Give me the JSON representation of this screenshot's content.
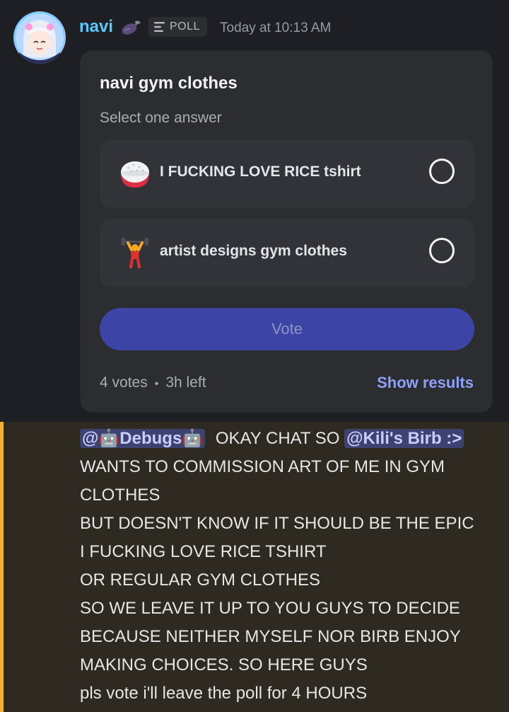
{
  "message": {
    "author": "navi",
    "tag": "POLL",
    "timestamp": "Today at 10:13 AM"
  },
  "poll": {
    "question": "navi gym clothes",
    "hint": "Select one answer",
    "answers": [
      {
        "emoji": "rice-bowl",
        "label": "I FUCKING LOVE RICE tshirt"
      },
      {
        "emoji": "person-lifting-weights",
        "label": "artist designs gym clothes"
      }
    ],
    "vote_label": "Vote",
    "votes": "4 votes",
    "separator": "•",
    "time_left": "3h left",
    "show_results": "Show results"
  },
  "reply": {
    "mention_1": "@🤖Debugs🤖",
    "text_1": "OKAY CHAT SO",
    "mention_2": "@Kili's Birb :>",
    "lines": [
      "WANTS TO COMMISSION ART OF ME IN GYM",
      "CLOTHES",
      "BUT DOESN'T KNOW IF IT SHOULD BE THE EPIC",
      "I FUCKING LOVE RICE TSHIRT",
      "OR REGULAR GYM CLOTHES",
      "SO WE LEAVE IT UP TO YOU GUYS TO DECIDE",
      "BECAUSE NEITHER MYSELF NOR BIRB ENJOY",
      "MAKING CHOICES. SO HERE GUYS",
      "pls vote i'll leave the poll for 4 HOURS"
    ]
  },
  "colors": {
    "background": "#1e1f24",
    "username": "#5ac8fa",
    "vote_button": "#3c45a5",
    "show_results": "#8ea1f7",
    "mention_highlight_bg": "#2e2a21",
    "mention_bar": "#f0b232",
    "mention_pill": "#3d4270"
  }
}
